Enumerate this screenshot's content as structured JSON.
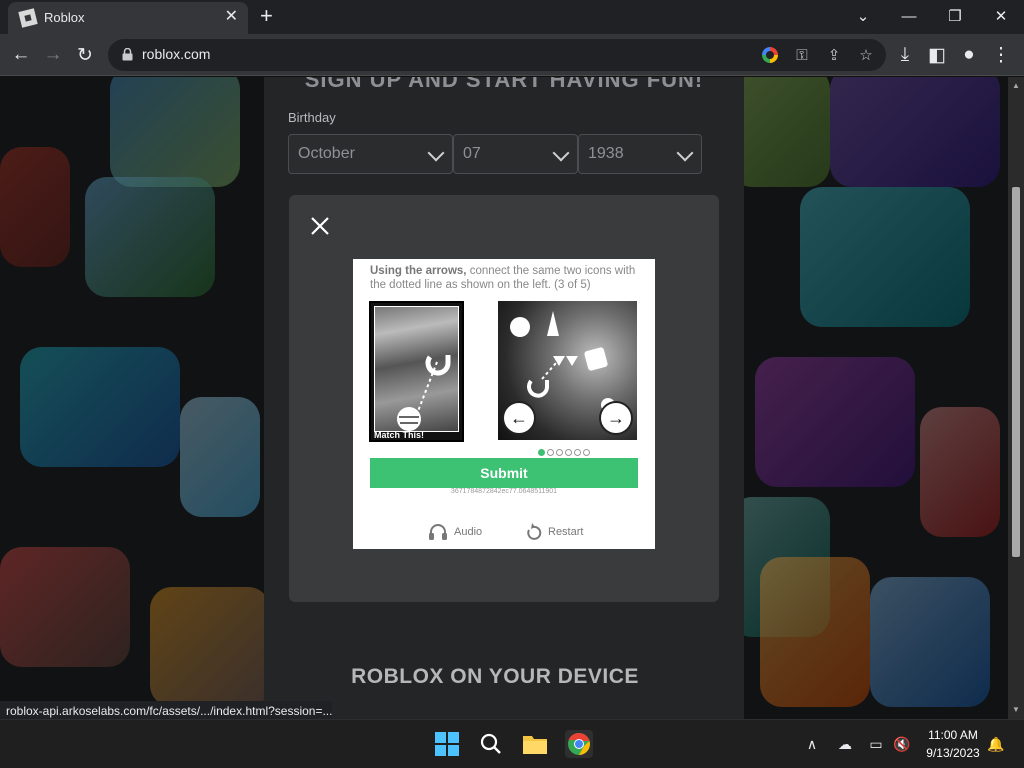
{
  "browser": {
    "tab_title": "Roblox",
    "tab_close": "✕",
    "new_tab": "+",
    "url": "roblox.com",
    "window_controls": {
      "minimize": "—",
      "restore": "❐",
      "close": "✕",
      "tab_search": "⌄"
    },
    "status_url": "roblox-api.arkoselabs.com/fc/assets/.../index.html?session=..."
  },
  "page": {
    "signup_heading": "SIGN UP AND START HAVING FUN!",
    "birthday_label": "Birthday",
    "birthday": {
      "month": "October",
      "day": "07",
      "year": "1938"
    },
    "device_heading": "ROBLOX ON YOUR DEVICE"
  },
  "captcha": {
    "instruction_bold": "Using the arrows,",
    "instruction_rest": " connect the same two icons with the dotted line as shown on the left. (3 of 5)",
    "match_label": "Match This!",
    "left_arrow": "←",
    "right_arrow": "→",
    "dots_total": 6,
    "dots_active": 1,
    "submit_label": "Submit",
    "session_id": "3671784872842ec77.0648511901",
    "audio_label": "Audio",
    "restart_label": "Restart"
  },
  "taskbar": {
    "time": "11:00 AM",
    "date": "9/13/2023"
  },
  "colors": {
    "submit_green": "#3dc274",
    "chrome_dark": "#202124",
    "chrome_toolbar": "#35363a"
  }
}
